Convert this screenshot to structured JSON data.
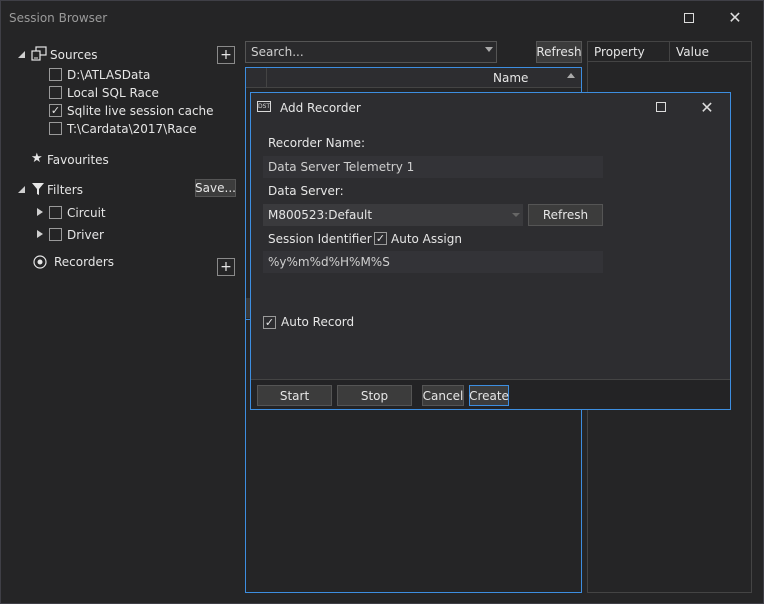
{
  "window": {
    "title": "Session Browser"
  },
  "sources": {
    "header": "Sources",
    "items": [
      {
        "label": "D:\\ATLASData",
        "checked": false
      },
      {
        "label": "Local SQL Race",
        "checked": false
      },
      {
        "label": "Sqlite live session cache",
        "checked": true
      },
      {
        "label": "T:\\Cardata\\2017\\Race",
        "checked": false
      }
    ]
  },
  "favourites": {
    "label": "Favourites"
  },
  "filters": {
    "label": "Filters",
    "save_label": "Save...",
    "items": [
      {
        "label": "Circuit"
      },
      {
        "label": "Driver"
      }
    ]
  },
  "recorders": {
    "label": "Recorders"
  },
  "search": {
    "placeholder": "Search...",
    "refresh_label": "Refresh"
  },
  "sessions_grid": {
    "column_name": "Name"
  },
  "properties": {
    "col_property": "Property",
    "col_value": "Value"
  },
  "dialog": {
    "icon_text": "DST",
    "title": "Add Recorder",
    "recorder_name_label": "Recorder Name:",
    "recorder_name_value": "Data Server Telemetry 1",
    "data_server_label": "Data Server:",
    "data_server_value": "M800523:Default",
    "refresh_label": "Refresh",
    "session_identifier_label": "Session Identifier",
    "auto_assign_label": "Auto Assign",
    "auto_assign_checked": true,
    "session_identifier_value": "%y%m%d%H%M%S",
    "auto_record_label": "Auto Record",
    "auto_record_checked": true,
    "buttons": {
      "start": "Start",
      "stop": "Stop",
      "cancel": "Cancel",
      "create": "Create"
    }
  },
  "colors": {
    "accent": "#3d8ee0",
    "background": "#252526",
    "dialog": "#2d2d30"
  }
}
